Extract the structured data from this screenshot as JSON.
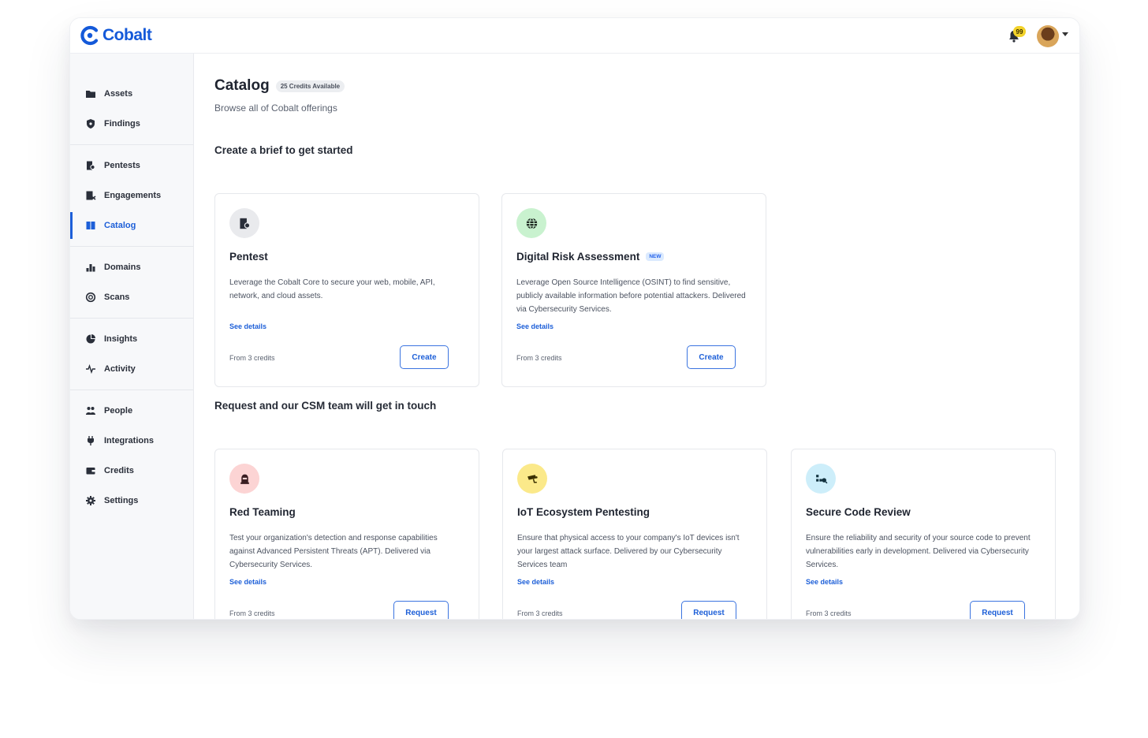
{
  "app": {
    "name": "Cobalt"
  },
  "header": {
    "notification_count": "99"
  },
  "sidebar": {
    "groups": [
      [
        {
          "label": "Assets",
          "icon": "folder-icon"
        },
        {
          "label": "Findings",
          "icon": "shield-icon"
        }
      ],
      [
        {
          "label": "Pentests",
          "icon": "pentest-icon"
        },
        {
          "label": "Engagements",
          "icon": "engagements-icon"
        },
        {
          "label": "Catalog",
          "icon": "book-icon",
          "active": true
        }
      ],
      [
        {
          "label": "Domains",
          "icon": "domains-icon"
        },
        {
          "label": "Scans",
          "icon": "scan-icon"
        }
      ],
      [
        {
          "label": "Insights",
          "icon": "pie-chart-icon"
        },
        {
          "label": "Activity",
          "icon": "pulse-icon"
        }
      ],
      [
        {
          "label": "People",
          "icon": "people-icon"
        },
        {
          "label": "Integrations",
          "icon": "plug-icon"
        },
        {
          "label": "Credits",
          "icon": "wallet-icon"
        },
        {
          "label": "Settings",
          "icon": "gear-icon"
        }
      ]
    ]
  },
  "main": {
    "title": "Catalog",
    "credits_badge": "25 Credits Available",
    "subtitle": "Browse all of Cobalt offerings",
    "section_brief": "Create a brief to get started",
    "section_request": "Request and our CSM team will get in touch",
    "brief_cards": [
      {
        "title": "Pentest",
        "description": "Leverage the Cobalt Core to secure your web, mobile, API, network, and cloud assets.",
        "link": "See details",
        "credits": "From 3 credits",
        "button": "Create",
        "icon": "pentest-icon",
        "icon_bg": "#e9eaed"
      },
      {
        "title": "Digital Risk Assessment",
        "tag": "NEW",
        "description": "Leverage Open Source Intelligence (OSINT) to find sensitive, publicly available information before potential attackers. Delivered via Cybersecurity Services.",
        "link": "See details",
        "credits": "From 3 credits",
        "button": "Create",
        "icon": "globe-icon",
        "icon_bg": "#c9f2cf"
      }
    ],
    "request_cards": [
      {
        "title": "Red Teaming",
        "description": "Test your organization's detection and response capabilities against Advanced Persistent Threats (APT). Delivered via Cybersecurity Services.",
        "link": "See details",
        "credits": "From 3 credits",
        "button": "Request",
        "icon": "hacker-icon",
        "icon_bg": "#fcd4d4"
      },
      {
        "title": "IoT Ecosystem Pentesting",
        "description": "Ensure that physical access to your company's IoT devices isn't your largest attack surface. Delivered by our Cybersecurity Services team",
        "link": "See details",
        "credits": "From 3 credits",
        "button": "Request",
        "icon": "camera-icon",
        "icon_bg": "#fbe98a"
      },
      {
        "title": "Secure Code Review",
        "description": "Ensure the reliability and security of your source code to prevent vulnerabilities early in development. Delivered via Cybersecurity Services.",
        "link": "See details",
        "credits": "From 3 credits",
        "button": "Request",
        "icon": "code-review-icon",
        "icon_bg": "#cdeefa"
      }
    ]
  },
  "colors": {
    "brand": "#1459d9",
    "accent": "#1d5fd8"
  }
}
